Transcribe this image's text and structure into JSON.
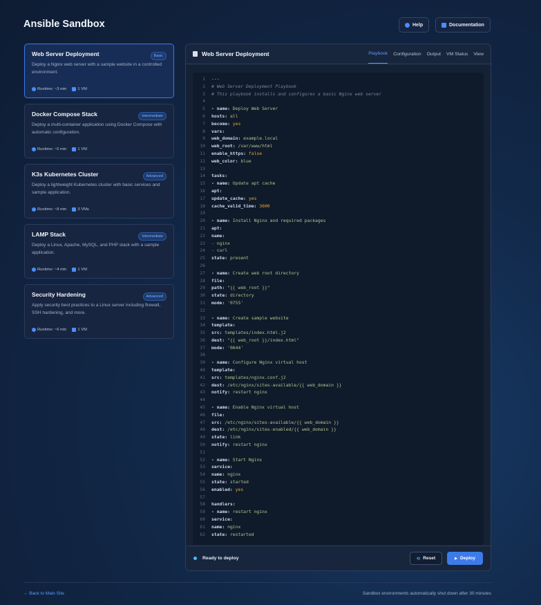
{
  "app": {
    "title": "Ansible Sandbox"
  },
  "header": {
    "help_label": "Help",
    "docs_label": "Documentation"
  },
  "scenarios": [
    {
      "title": "Web Server Deployment",
      "badge": "Basic",
      "description": "Deploy a Nginx web server with a sample website in a controlled environment.",
      "runtime": "Runtime: ~3 min",
      "vms": "1 VM",
      "active": true
    },
    {
      "title": "Docker Compose Stack",
      "badge": "Intermediate",
      "description": "Deploy a multi-container application using Docker Compose with automatic configuration.",
      "runtime": "Runtime: ~5 min",
      "vms": "1 VM"
    },
    {
      "title": "K3s Kubernetes Cluster",
      "badge": "Advanced",
      "description": "Deploy a lightweight Kubernetes cluster with basic services and sample application.",
      "runtime": "Runtime: ~8 min",
      "vms": "3 VMs"
    },
    {
      "title": "LAMP Stack",
      "badge": "Intermediate",
      "description": "Deploy a Linux, Apache, MySQL, and PHP stack with a sample application.",
      "runtime": "Runtime: ~4 min",
      "vms": "1 VM"
    },
    {
      "title": "Security Hardening",
      "badge": "Advanced",
      "description": "Apply security best practices to a Linux server including firewall, SSH hardening, and more.",
      "runtime": "Runtime: ~6 min",
      "vms": "1 VM"
    }
  ],
  "editor": {
    "title": "Web Server Deployment",
    "tabs": [
      "Playbook",
      "Configuration",
      "Output",
      "VM Status",
      "View"
    ],
    "active_tab": "Playbook",
    "code": [
      [
        [
          "plain",
          "---"
        ]
      ],
      [
        [
          "comment",
          "# Web Server Deployment Playbook"
        ]
      ],
      [
        [
          "comment",
          "# This playbook installs and configures a basic Nginx web server"
        ]
      ],
      [],
      [
        [
          "key",
          "- name: "
        ],
        [
          "str",
          "Deploy Web Server"
        ]
      ],
      [
        [
          "key",
          "hosts: "
        ],
        [
          "str",
          "all"
        ]
      ],
      [
        [
          "key",
          "become: "
        ],
        [
          "bool",
          "yes"
        ]
      ],
      [
        [
          "key",
          "vars:"
        ]
      ],
      [
        [
          "key",
          "web_domain: "
        ],
        [
          "str",
          "example.local"
        ]
      ],
      [
        [
          "key",
          "web_root: "
        ],
        [
          "str",
          "/var/www/html"
        ]
      ],
      [
        [
          "key",
          "enable_https: "
        ],
        [
          "bool",
          "false"
        ]
      ],
      [
        [
          "key",
          "web_color: "
        ],
        [
          "str",
          "blue"
        ]
      ],
      [],
      [
        [
          "key",
          "tasks:"
        ]
      ],
      [
        [
          "key",
          "- name: "
        ],
        [
          "str",
          "Update apt cache"
        ]
      ],
      [
        [
          "key",
          "apt:"
        ]
      ],
      [
        [
          "key",
          "update_cache: "
        ],
        [
          "bool",
          "yes"
        ]
      ],
      [
        [
          "key",
          "cache_valid_time: "
        ],
        [
          "num",
          "3600"
        ]
      ],
      [],
      [
        [
          "key",
          "- name: "
        ],
        [
          "str",
          "Install Nginx and required packages"
        ]
      ],
      [
        [
          "key",
          "apt:"
        ]
      ],
      [
        [
          "key",
          "name:"
        ]
      ],
      [
        [
          "str",
          "- nginx"
        ]
      ],
      [
        [
          "str",
          "- curl"
        ]
      ],
      [
        [
          "key",
          "state: "
        ],
        [
          "str",
          "present"
        ]
      ],
      [],
      [
        [
          "key",
          "- name: "
        ],
        [
          "str",
          "Create web root directory"
        ]
      ],
      [
        [
          "key",
          "file:"
        ]
      ],
      [
        [
          "key",
          "path: "
        ],
        [
          "str",
          "\"{{ web_root }}\""
        ]
      ],
      [
        [
          "key",
          "state: "
        ],
        [
          "str",
          "directory"
        ]
      ],
      [
        [
          "key",
          "mode: "
        ],
        [
          "str",
          "'0755'"
        ]
      ],
      [],
      [
        [
          "key",
          "- name: "
        ],
        [
          "str",
          "Create sample website"
        ]
      ],
      [
        [
          "key",
          "template:"
        ]
      ],
      [
        [
          "key",
          "src: "
        ],
        [
          "str",
          "templates/index.html.j2"
        ]
      ],
      [
        [
          "key",
          "dest: "
        ],
        [
          "str",
          "\"{{ web_root }}/index.html\""
        ]
      ],
      [
        [
          "key",
          "mode: "
        ],
        [
          "str",
          "'0644'"
        ]
      ],
      [],
      [
        [
          "key",
          "- name: "
        ],
        [
          "str",
          "Configure Nginx virtual host"
        ]
      ],
      [
        [
          "key",
          "template:"
        ]
      ],
      [
        [
          "key",
          "src: "
        ],
        [
          "str",
          "templates/nginx.conf.j2"
        ]
      ],
      [
        [
          "key",
          "dest: "
        ],
        [
          "str",
          "/etc/nginx/sites-available/{{ web_domain }}"
        ]
      ],
      [
        [
          "key",
          "notify: "
        ],
        [
          "str",
          "restart nginx"
        ]
      ],
      [],
      [
        [
          "key",
          "- name: "
        ],
        [
          "str",
          "Enable Nginx virtual host"
        ]
      ],
      [
        [
          "key",
          "file:"
        ]
      ],
      [
        [
          "key",
          "src: "
        ],
        [
          "str",
          "/etc/nginx/sites-available/{{ web_domain }}"
        ]
      ],
      [
        [
          "key",
          "dest: "
        ],
        [
          "str",
          "/etc/nginx/sites-enabled/{{ web_domain }}"
        ]
      ],
      [
        [
          "key",
          "state: "
        ],
        [
          "str",
          "link"
        ]
      ],
      [
        [
          "key",
          "notify: "
        ],
        [
          "str",
          "restart nginx"
        ]
      ],
      [],
      [
        [
          "key",
          "- name: "
        ],
        [
          "str",
          "Start Nginx"
        ]
      ],
      [
        [
          "key",
          "service:"
        ]
      ],
      [
        [
          "key",
          "name: "
        ],
        [
          "str",
          "nginx"
        ]
      ],
      [
        [
          "key",
          "state: "
        ],
        [
          "str",
          "started"
        ]
      ],
      [
        [
          "key",
          "enabled: "
        ],
        [
          "bool",
          "yes"
        ]
      ],
      [],
      [
        [
          "key",
          "handlers:"
        ]
      ],
      [
        [
          "key",
          "- name: "
        ],
        [
          "str",
          "restart nginx"
        ]
      ],
      [
        [
          "key",
          "service:"
        ]
      ],
      [
        [
          "key",
          "name: "
        ],
        [
          "str",
          "nginx"
        ]
      ],
      [
        [
          "key",
          "state: "
        ],
        [
          "str",
          "restarted"
        ]
      ]
    ],
    "status": "Ready to deploy",
    "reset_label": "Reset",
    "deploy_label": "Deploy"
  },
  "footer": {
    "back_link": "← Back to Main Site",
    "note": "Sandbox environments automatically shut down after 30 minutes"
  },
  "colors": {
    "accent": "#3d7bea",
    "background": "#12294a"
  }
}
